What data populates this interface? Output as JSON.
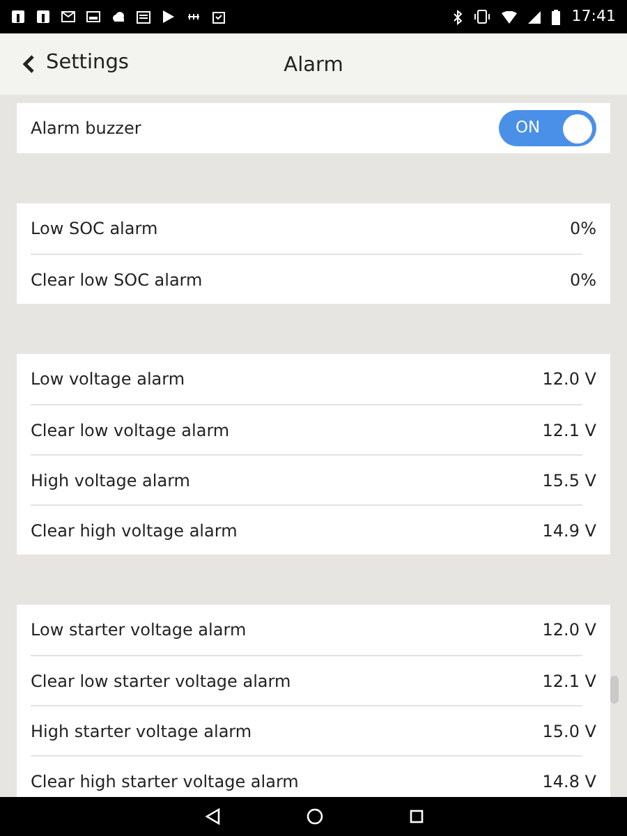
{
  "status_bar": {
    "time": "17:41"
  },
  "header": {
    "back_label": "Settings",
    "title": "Alarm"
  },
  "groups": [
    {
      "rows": [
        {
          "kind": "toggle",
          "label": "Alarm buzzer",
          "on": true,
          "state_text": "ON"
        }
      ]
    },
    {
      "rows": [
        {
          "kind": "value",
          "label": "Low SOC alarm",
          "value": "0%"
        },
        {
          "kind": "value",
          "label": "Clear low SOC alarm",
          "value": "0%"
        }
      ]
    },
    {
      "rows": [
        {
          "kind": "value",
          "label": "Low voltage alarm",
          "value": "12.0 V"
        },
        {
          "kind": "value",
          "label": "Clear low voltage alarm",
          "value": "12.1 V"
        },
        {
          "kind": "value",
          "label": "High voltage alarm",
          "value": "15.5 V"
        },
        {
          "kind": "value",
          "label": "Clear high voltage alarm",
          "value": "14.9 V"
        }
      ]
    },
    {
      "rows": [
        {
          "kind": "value",
          "label": "Low starter voltage alarm",
          "value": "12.0 V"
        },
        {
          "kind": "value",
          "label": "Clear low starter voltage alarm",
          "value": "12.1 V"
        },
        {
          "kind": "value",
          "label": "High starter voltage alarm",
          "value": "15.0 V"
        },
        {
          "kind": "value",
          "label": "Clear high starter voltage alarm",
          "value": "14.8 V"
        }
      ]
    }
  ]
}
